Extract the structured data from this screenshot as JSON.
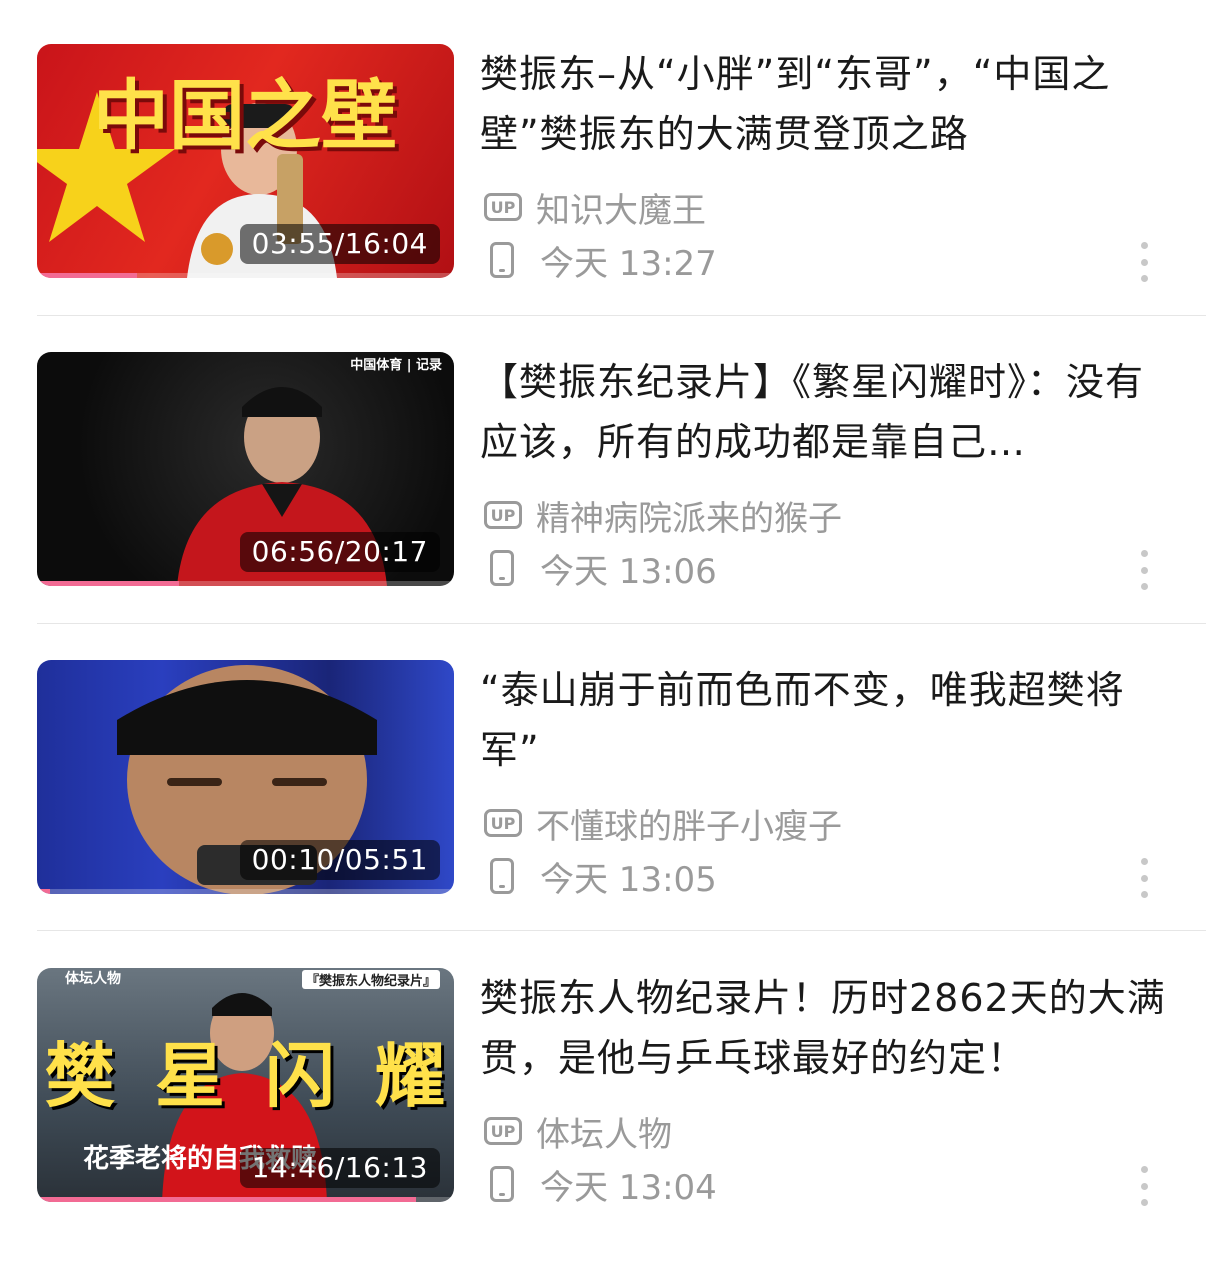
{
  "items": [
    {
      "title": "樊振东–从“小胖”到“东哥”，“中国之壁”樊振东的大满贯登顶之路",
      "uploader": "知识大魔王",
      "time": "今天 13:27",
      "duration": "03:55/16:04",
      "progress": 0.24,
      "thumb_text": "中国之壁"
    },
    {
      "title": "【樊振东纪录片】《繁星闪耀时》：没有应该，所有的成功都是靠自己…",
      "uploader": "精神病院派来的猴子",
      "time": "今天 13:06",
      "duration": "06:56/20:17",
      "progress": 0.34,
      "thumb_text": "中国体育 | 记录"
    },
    {
      "title": "“泰山崩于前而色而不变，唯我超樊将军”",
      "uploader": "不懂球的胖子小瘦子",
      "time": "今天 13:05",
      "duration": "00:10/05:51",
      "progress": 0.03,
      "thumb_text": ""
    },
    {
      "title": "樊振东人物纪录片！历时2862天的大满贯，是他与乒乓球最好的约定！",
      "uploader": "体坛人物",
      "time": "今天 13:04",
      "duration": "14:46/16:13",
      "progress": 0.91,
      "thumb_text": "樊星闪耀",
      "thumb_badge": "『樊振东人物纪录片』",
      "thumb_brand": "体坛人物",
      "thumb_sub": "花季老将的自我救赎"
    }
  ],
  "icons": {
    "uploader": "up-icon",
    "device": "phone-icon",
    "menu": "more-icon"
  },
  "colors": {
    "progress": "#f26b94",
    "meta": "#9a9a9a"
  }
}
